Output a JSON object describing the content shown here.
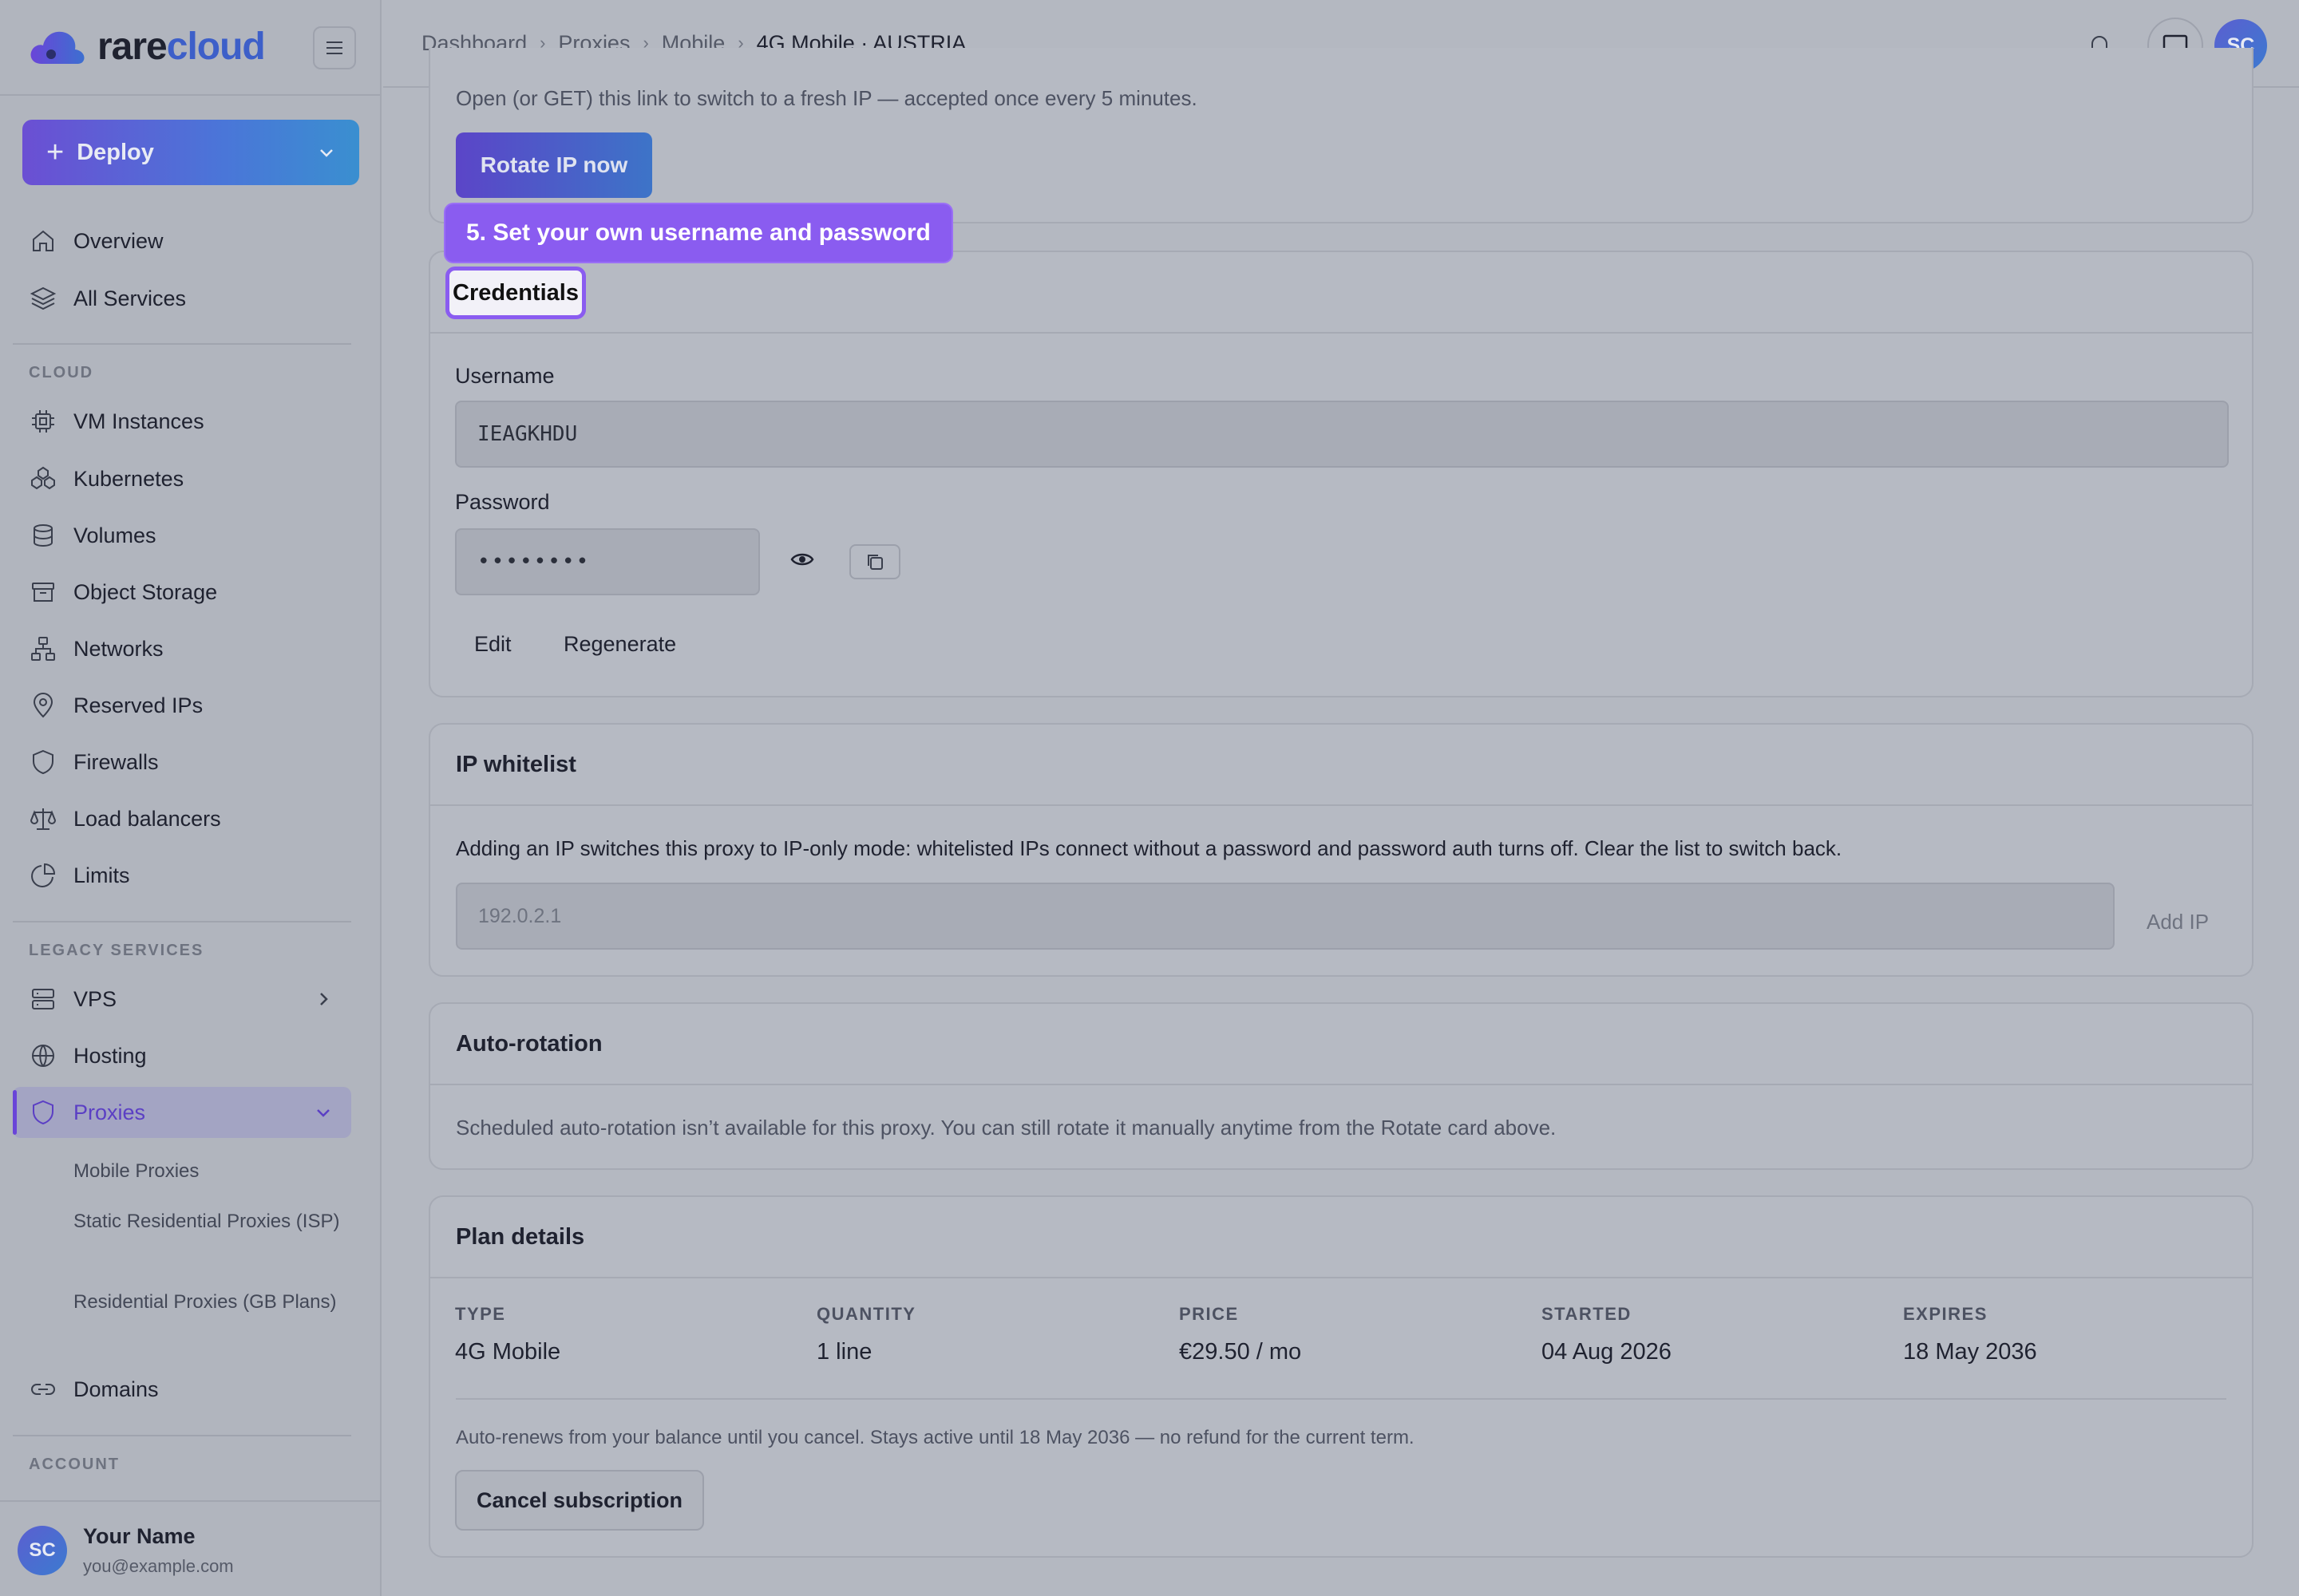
{
  "brand": {
    "name_part1": "rare",
    "name_part2": "cloud"
  },
  "sidebar": {
    "deploy_label": "Deploy",
    "items_top": [
      {
        "label": "Overview",
        "icon": "home-icon"
      },
      {
        "label": "All Services",
        "icon": "layers-icon"
      }
    ],
    "section_cloud": "CLOUD",
    "cloud_items": [
      {
        "label": "VM Instances",
        "icon": "cpu-icon"
      },
      {
        "label": "Kubernetes",
        "icon": "kubernetes-icon"
      },
      {
        "label": "Volumes",
        "icon": "database-icon"
      },
      {
        "label": "Object Storage",
        "icon": "archive-icon"
      },
      {
        "label": "Networks",
        "icon": "network-icon"
      },
      {
        "label": "Reserved IPs",
        "icon": "map-pin-icon"
      },
      {
        "label": "Firewalls",
        "icon": "shield-icon"
      },
      {
        "label": "Load balancers",
        "icon": "scale-icon"
      },
      {
        "label": "Limits",
        "icon": "pie-chart-icon"
      }
    ],
    "section_legacy": "LEGACY SERVICES",
    "legacy_items": [
      {
        "label": "VPS",
        "icon": "server-icon"
      },
      {
        "label": "Hosting",
        "icon": "globe-icon"
      },
      {
        "label": "Proxies",
        "icon": "shield-icon"
      }
    ],
    "proxy_sub_items": [
      "Mobile Proxies",
      "Static Residential Proxies (ISP)",
      "Residential Proxies (GB Plans)"
    ],
    "domains_label": "Domains",
    "section_account": "ACCOUNT",
    "profile": {
      "initials": "SC",
      "name": "Your Name",
      "email": "you@example.com"
    }
  },
  "header": {
    "breadcrumbs": [
      "Dashboard",
      "Proxies",
      "Mobile",
      "4G Mobile · AUSTRIA"
    ],
    "avatar_initials": "SC"
  },
  "rotate": {
    "description": "Open (or GET) this link to switch to a fresh IP — accepted once every 5 minutes.",
    "button_label": "Rotate IP now"
  },
  "callout": {
    "text": "5. Set your own username and password"
  },
  "credentials": {
    "title": "Credentials",
    "username_label": "Username",
    "username_value": "IEAGKHDU",
    "password_label": "Password",
    "password_value": "••••••••",
    "edit_label": "Edit",
    "regenerate_label": "Regenerate"
  },
  "whitelist": {
    "title": "IP whitelist",
    "description": "Adding an IP switches this proxy to IP-only mode: whitelisted IPs connect without a password and password auth turns off. Clear the list to switch back.",
    "input_placeholder": "192.0.2.1",
    "add_label": "Add IP"
  },
  "autorotation": {
    "title": "Auto-rotation",
    "description": "Scheduled auto-rotation isn’t available for this proxy. You can still rotate it manually anytime from the Rotate card above."
  },
  "plan": {
    "title": "Plan details",
    "columns": [
      {
        "key": "TYPE",
        "value": "4G Mobile"
      },
      {
        "key": "QUANTITY",
        "value": "1 line"
      },
      {
        "key": "PRICE",
        "value": "€29.50 / mo"
      },
      {
        "key": "STARTED",
        "value": "04 Aug 2026"
      },
      {
        "key": "EXPIRES",
        "value": "18 May 2036"
      }
    ],
    "note": "Auto-renews from your balance until you cancel. Stays active until 18 May 2036 — no refund for the current term.",
    "cancel_label": "Cancel subscription"
  },
  "colors": {
    "accent": "#6a45d8",
    "callout": "#8a5cf0",
    "brand_blue": "#3d5fc9"
  }
}
